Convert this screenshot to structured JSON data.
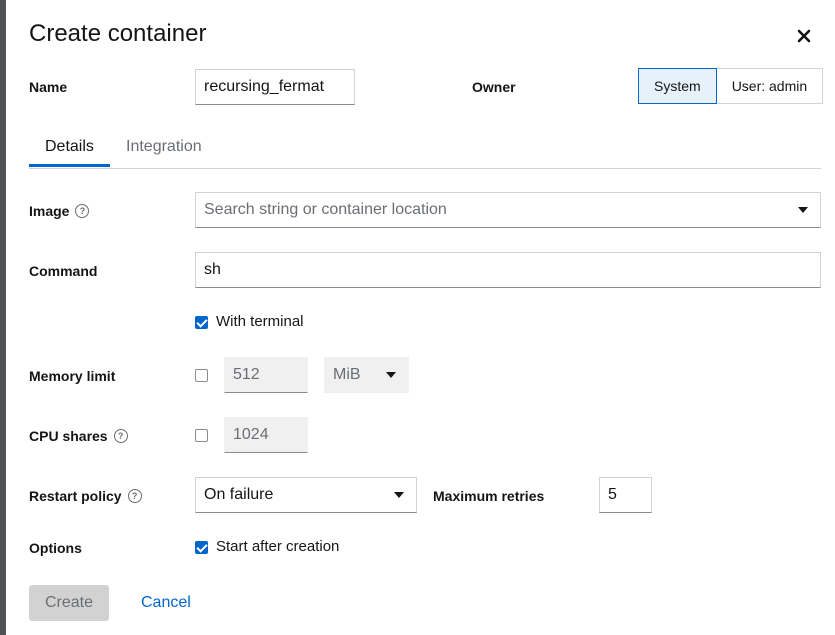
{
  "dialog": {
    "title": "Create container"
  },
  "name": {
    "label": "Name",
    "value": "recursing_fermat"
  },
  "owner": {
    "label": "Owner",
    "options": [
      "System",
      "User: admin"
    ],
    "selected": "System"
  },
  "tabs": [
    {
      "label": "Details",
      "active": true
    },
    {
      "label": "Integration",
      "active": false
    }
  ],
  "image": {
    "label": "Image",
    "placeholder": "Search string or container location"
  },
  "command": {
    "label": "Command",
    "value": "sh"
  },
  "terminal": {
    "label": "With terminal",
    "checked": true
  },
  "memory": {
    "label": "Memory limit",
    "checked": false,
    "value": "512",
    "unit": "MiB"
  },
  "cpu": {
    "label": "CPU shares",
    "checked": false,
    "value": "1024"
  },
  "restart": {
    "label": "Restart policy",
    "value": "On failure",
    "retries_label": "Maximum retries",
    "retries_value": "5"
  },
  "options": {
    "label": "Options",
    "start_label": "Start after creation",
    "start_checked": true
  },
  "buttons": {
    "create": "Create",
    "cancel": "Cancel"
  },
  "colors": {
    "accent": "#0066cc",
    "disabled_bg": "#d2d2d2"
  }
}
